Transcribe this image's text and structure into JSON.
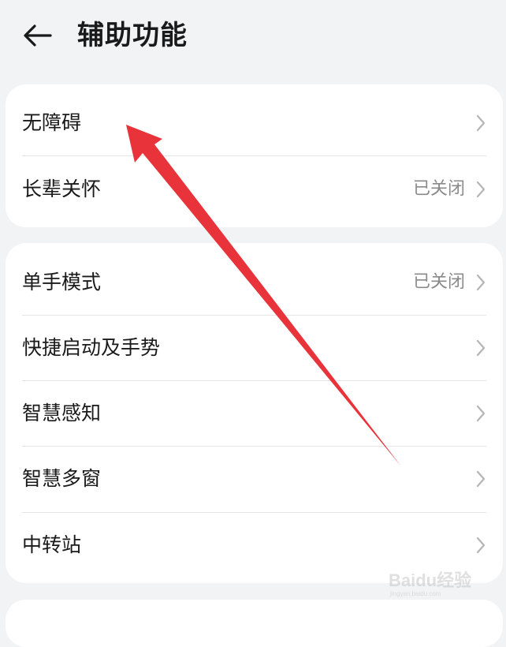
{
  "header": {
    "title": "辅助功能",
    "back_icon": "arrow-left-icon"
  },
  "groups": [
    {
      "items": [
        {
          "label": "无障碍",
          "value": ""
        },
        {
          "label": "长辈关怀",
          "value": "已关闭"
        }
      ]
    },
    {
      "items": [
        {
          "label": "单手模式",
          "value": "已关闭"
        },
        {
          "label": "快捷启动及手势",
          "value": ""
        },
        {
          "label": "智慧感知",
          "value": ""
        },
        {
          "label": "智慧多窗",
          "value": ""
        },
        {
          "label": "中转站",
          "value": ""
        }
      ]
    }
  ],
  "annotation": {
    "color": "#e8333b",
    "points_to": "无障碍"
  },
  "watermark": {
    "text": "Baidu经验",
    "subtext": "jingyan.baidu.com"
  },
  "colors": {
    "background": "#f1f3f5",
    "card": "#ffffff",
    "text_primary": "#1a1a1a",
    "text_secondary": "#8a8a8a",
    "chevron": "#b5b5b5"
  }
}
